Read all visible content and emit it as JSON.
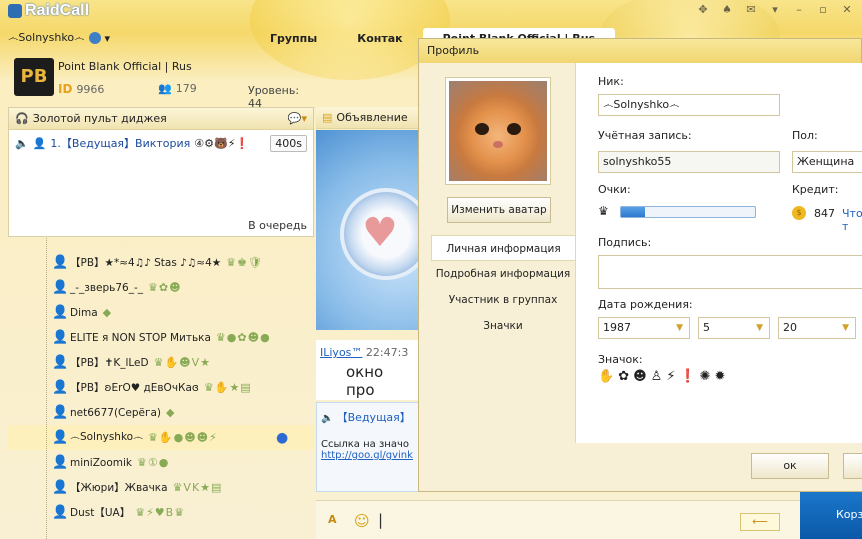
{
  "app": {
    "brand": "RaidCall",
    "window_icons": [
      "gamepad-icon",
      "shirt-icon",
      "mail-icon",
      "dropdown-icon",
      "minimize-icon",
      "maximize-icon",
      "close-icon"
    ]
  },
  "user": {
    "nickname": "෴Solnyshko෴",
    "status": "online"
  },
  "tabs": [
    {
      "label": "Группы"
    },
    {
      "label": "Контак"
    },
    {
      "label": "Point Blank Official | Rus"
    }
  ],
  "channel": {
    "name": "Point Blank Official | Rus",
    "id_label": "ID",
    "id_value": "9966",
    "members": "179",
    "level": "Уровень: 44"
  },
  "mic_panel": {
    "title": "Золотой пульт диджея",
    "current_speaker": "1.【Ведущая】Виктория",
    "timer": "400s",
    "queue_label": "В очередь"
  },
  "user_list": [
    {
      "name": "【PB】★*≈4♫♪ Stas ♪♫≈4★"
    },
    {
      "name": "_-_зверь76_-_"
    },
    {
      "name": "Dima"
    },
    {
      "name": "ELITE я NON STOP Митька"
    },
    {
      "name": "【PB】✝K_lLeD"
    },
    {
      "name": "【PB】ʚErO♥ дЕвОчКаɞ"
    },
    {
      "name": "net6677(Серёга)"
    },
    {
      "name": "෴Solnyshko෴"
    },
    {
      "name": "miniZoomik"
    },
    {
      "name": "【Жюри】Жвачка"
    },
    {
      "name": "Dust【UA】"
    }
  ],
  "announcement": {
    "tab_label": "Объявление",
    "chat_nick": "ILiyos™",
    "chat_time": "22:47:3",
    "chat_message": "окно про",
    "notice_title": "【Ведущая】",
    "notice_body": "Ссылка на значо",
    "notice_link": "http://goo.gl/gvink"
  },
  "desktop_text": "Корз",
  "profile": {
    "title": "Профиль",
    "change_avatar": "Изменить аватар",
    "nav": [
      {
        "label": "Личная информация",
        "active": true
      },
      {
        "label": "Подробная информация",
        "active": false
      },
      {
        "label": "Участник в группах",
        "active": false
      },
      {
        "label": "Значки",
        "active": false
      }
    ],
    "nick_label": "Ник:",
    "nick_value": "෴Solnyshko෴",
    "account_label": "Учётная запись:",
    "account_value": "solnyshko55",
    "gender_label": "Пол:",
    "gender_value": "Женщина",
    "points_label": "Очки:",
    "points_progress": 0.18,
    "credit_label": "Кредит:",
    "credit_value": "847",
    "credit_more": "Что т",
    "signature_label": "Подпись:",
    "signature_value": "",
    "birthday_label": "Дата рождения:",
    "birth_year": "1987",
    "birth_month": "5",
    "birth_day": "20",
    "badge_label": "Значок:",
    "ok_label": "ок"
  }
}
